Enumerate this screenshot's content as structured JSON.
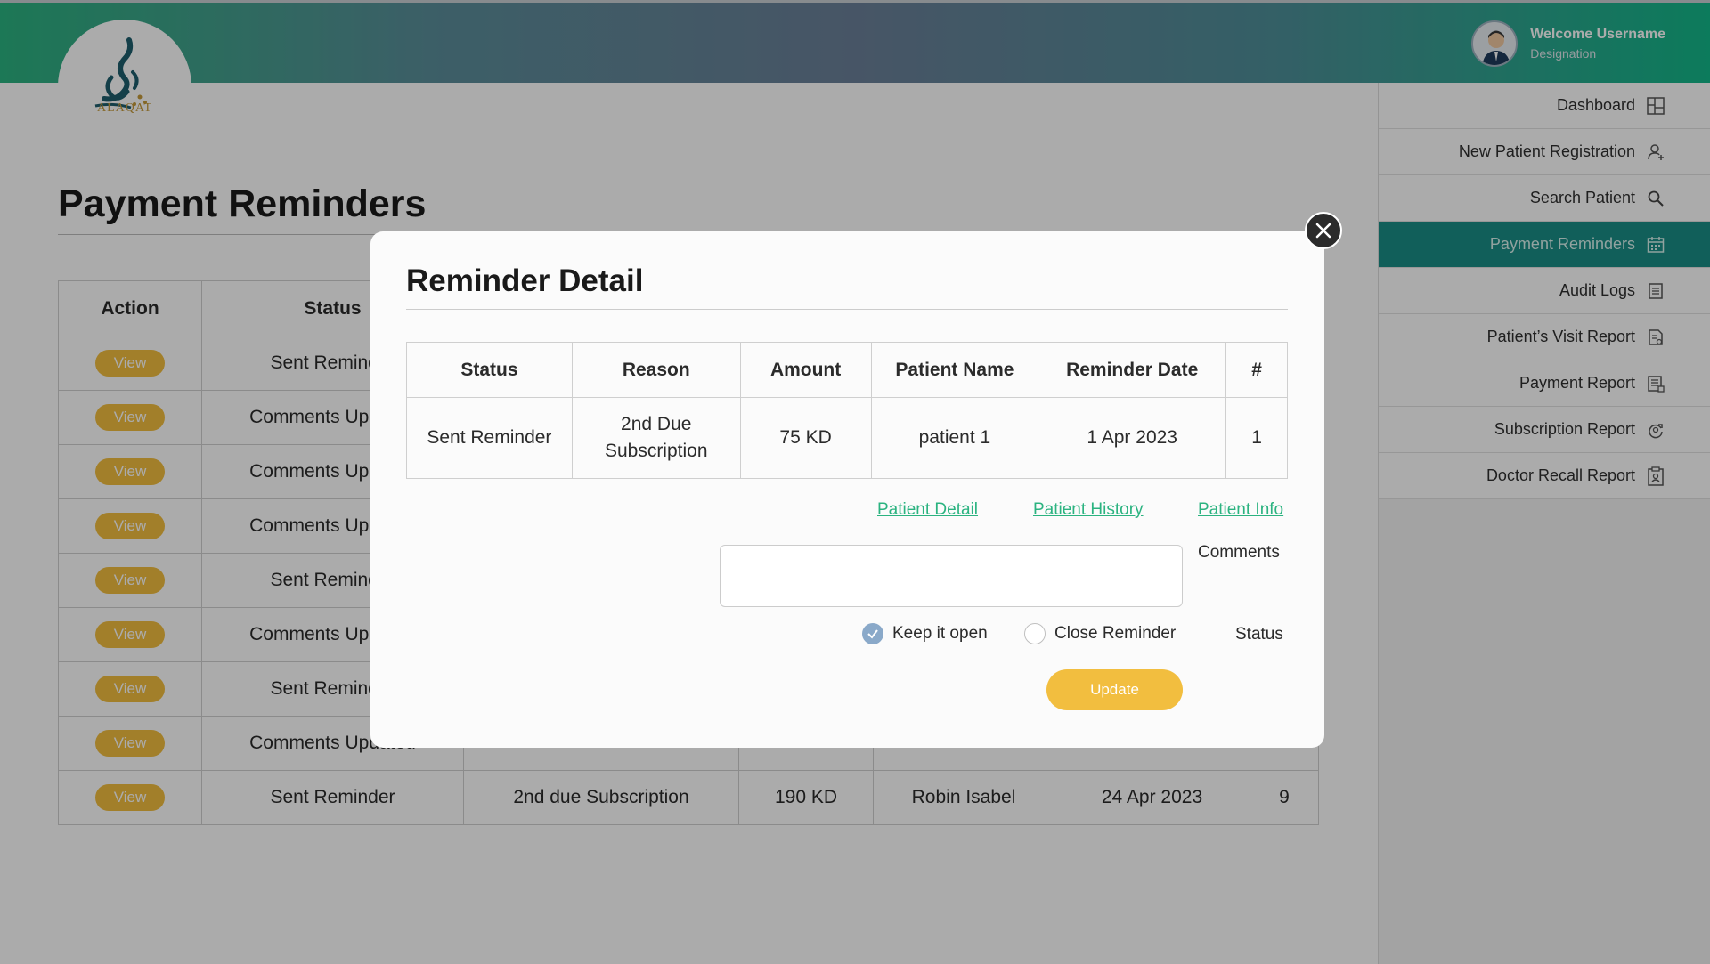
{
  "header": {
    "logo_text": "ALAQAT",
    "welcome": "Welcome Username",
    "designation": "Designation"
  },
  "sidebar": {
    "items": [
      {
        "label": "Dashboard",
        "icon": "dashboard-icon"
      },
      {
        "label": "New Patient Registration",
        "icon": "add-user-icon"
      },
      {
        "label": "Search Patient",
        "icon": "search-icon"
      },
      {
        "label": "Payment Reminders",
        "icon": "calendar-icon",
        "active": true
      },
      {
        "label": "Audit Logs",
        "icon": "document-icon"
      },
      {
        "label": "Patient’s Visit Report",
        "icon": "report-icon"
      },
      {
        "label": "Payment Report",
        "icon": "receipt-icon"
      },
      {
        "label": "Subscription Report",
        "icon": "refresh-icon"
      },
      {
        "label": "Doctor Recall Report",
        "icon": "clipboard-icon"
      }
    ]
  },
  "page": {
    "title": "Payment Reminders"
  },
  "main_table": {
    "headers": [
      "Action",
      "Status",
      "",
      "",
      "",
      "",
      ""
    ],
    "view_label": "View",
    "rows": [
      [
        "Sent Reminder",
        "",
        "",
        "",
        "",
        ""
      ],
      [
        "Comments Updated",
        "",
        "",
        "",
        "",
        ""
      ],
      [
        "Comments Updated",
        "",
        "",
        "",
        "",
        ""
      ],
      [
        "Comments Updated",
        "",
        "",
        "",
        "",
        ""
      ],
      [
        "Sent Reminder",
        "",
        "",
        "",
        "",
        ""
      ],
      [
        "Comments Updated",
        "",
        "",
        "",
        "",
        ""
      ],
      [
        "Sent Reminder",
        "",
        "",
        "",
        "",
        ""
      ],
      [
        "Comments Updated",
        "",
        "",
        "",
        "",
        ""
      ],
      [
        "Sent Reminder",
        "2nd due Subscription",
        "190 KD",
        "Robin Isabel",
        "24 Apr 2023",
        "9"
      ]
    ]
  },
  "modal": {
    "title": "Reminder Detail",
    "table": {
      "headers": [
        "Status",
        "Reason",
        "Amount",
        "Patient Name",
        "Reminder Date",
        "#"
      ],
      "row": [
        "Sent Reminder",
        "2nd Due Subscription",
        "75 KD",
        "patient 1",
        "1 Apr 2023",
        "1"
      ]
    },
    "links": {
      "patient_detail": "Patient Detail",
      "patient_history": "Patient History",
      "patient_info": "Patient Info"
    },
    "comments_label": "Comments",
    "comments_value": "",
    "status_label": "Status",
    "radio_keep_open": "Keep it open",
    "radio_close": "Close Reminder",
    "selected_status": "Keep it open",
    "update_label": "Update"
  },
  "colors": {
    "accent_green": "#2bb380",
    "active_teal": "#1a8e86",
    "button_yellow": "#f2be3f"
  }
}
